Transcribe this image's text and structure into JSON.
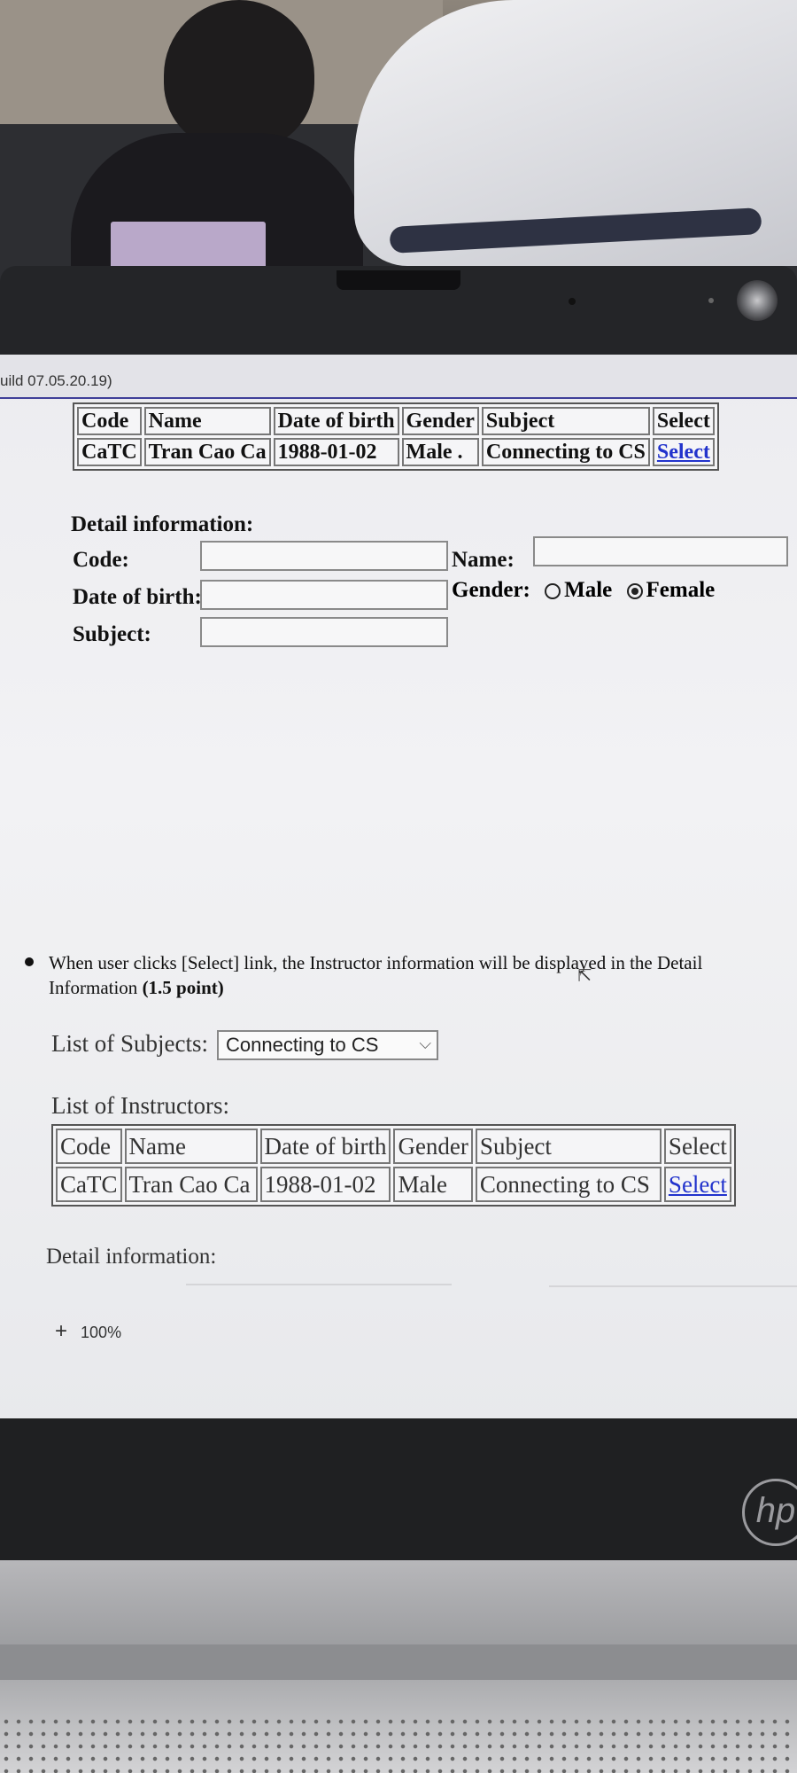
{
  "window": {
    "title_fragment": "uild 07.05.20.19)"
  },
  "table_columns": [
    "Code",
    "Name",
    "Date of birth",
    "Gender",
    "Subject",
    "Select"
  ],
  "top_table": {
    "rows": [
      {
        "code": "CaTC",
        "name": "Tran Cao Ca",
        "dob": "1988-01-02",
        "gender": "Male",
        "marker": ".",
        "subject": "Connecting to CS",
        "select": "Select"
      }
    ]
  },
  "detail_form": {
    "heading": "Detail information:",
    "code_label": "Code:",
    "name_label": "Name:",
    "dob_label": "Date of birth:",
    "gender_label": "Gender:",
    "subject_label": "Subject:",
    "gender_options": [
      "Male",
      "Female"
    ],
    "gender_selected": "Female"
  },
  "instruction": {
    "text": "When user clicks [Select] link, the Instructor information will be displayed in the Detail Information",
    "points": "(1.5 point)"
  },
  "subjects": {
    "label": "List of Subjects:",
    "selected": "Connecting to CS"
  },
  "instructors": {
    "label": "List of Instructors:",
    "rows": [
      {
        "code": "CaTC",
        "name": "Tran Cao Ca",
        "dob": "1988-01-02",
        "gender": "Male",
        "subject": "Connecting to CS",
        "select": "Select"
      }
    ]
  },
  "detail_label_2": "Detail information:",
  "zoom": {
    "plus": "+",
    "level": "100%"
  },
  "brand": "hp"
}
